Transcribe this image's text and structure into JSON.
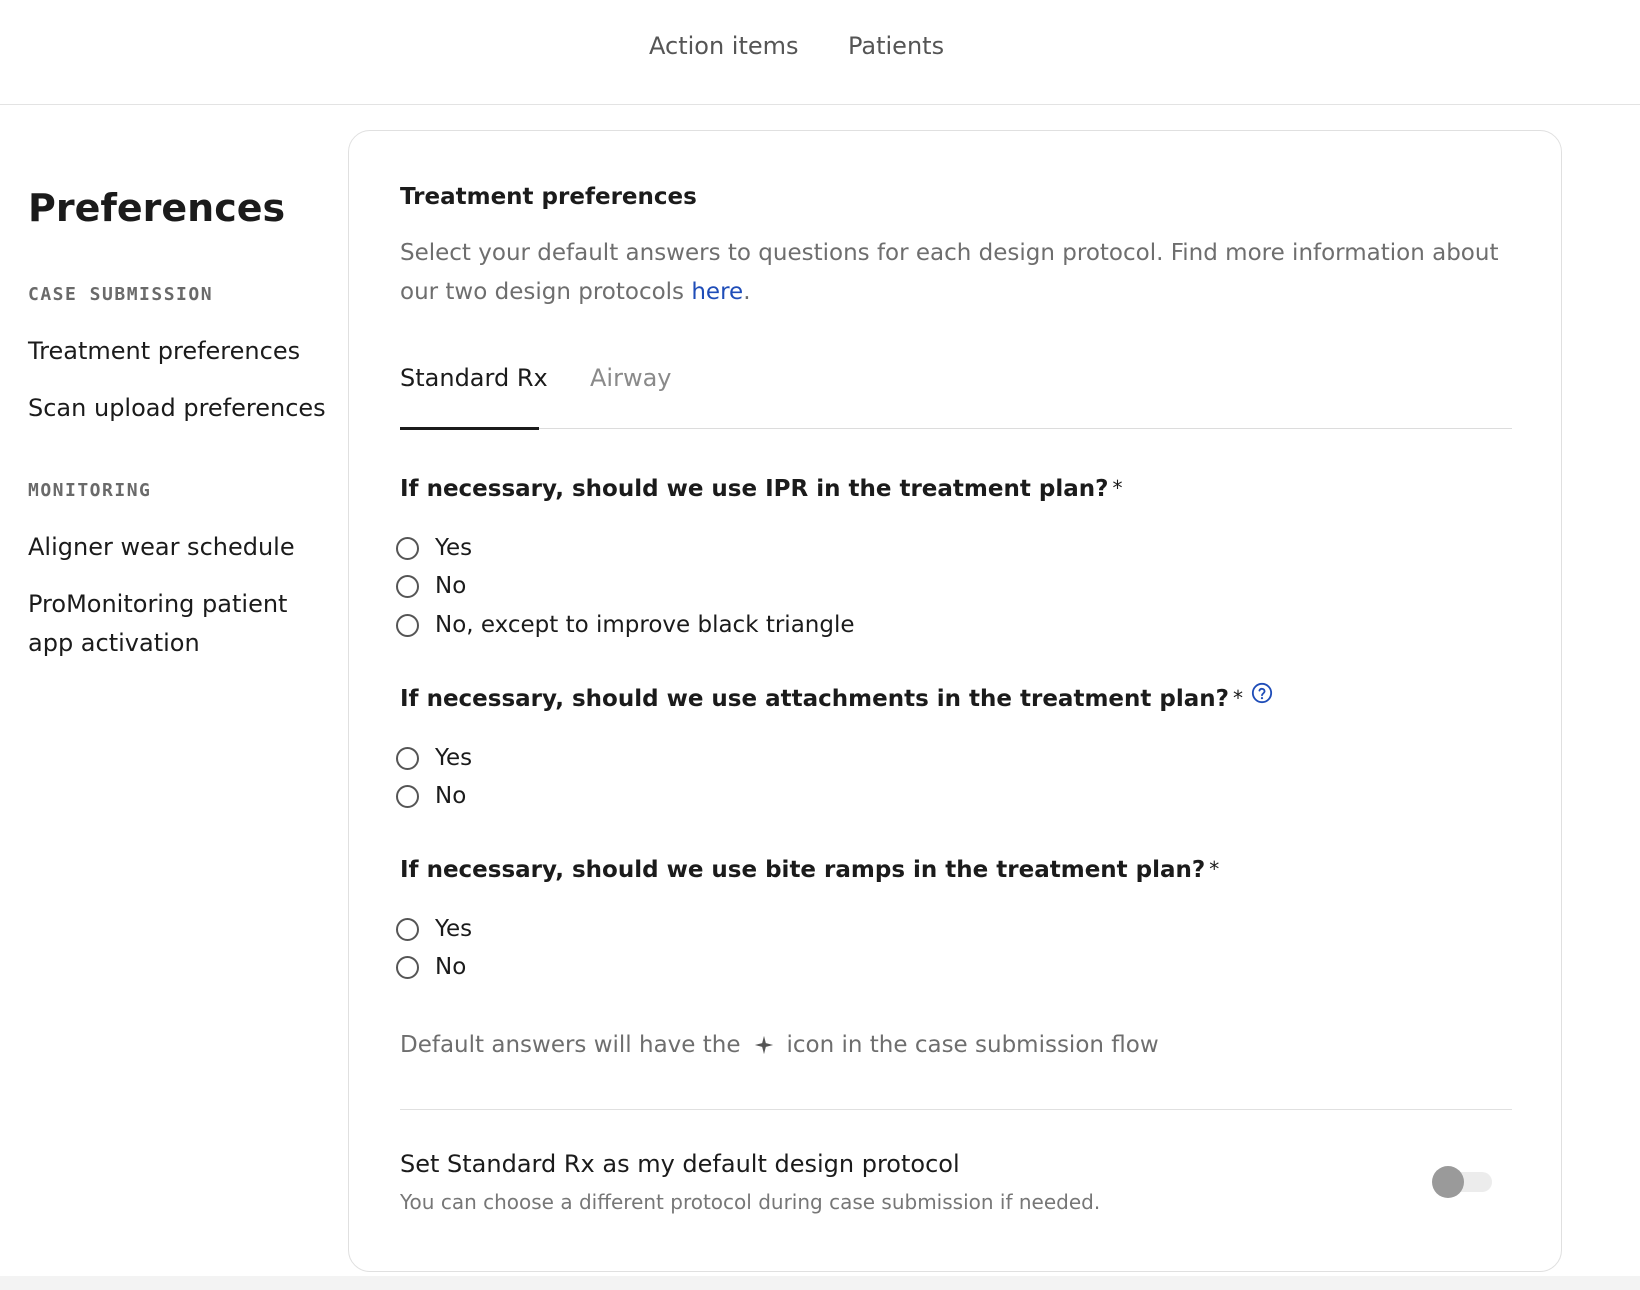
{
  "topnav": {
    "items": [
      {
        "label": "Action items"
      },
      {
        "label": "Patients"
      }
    ]
  },
  "sidebar": {
    "title": "Preferences",
    "sections": [
      {
        "heading": "CASE SUBMISSION",
        "items": [
          {
            "label": "Treatment preferences"
          },
          {
            "label": "Scan upload preferences"
          }
        ]
      },
      {
        "heading": "MONITORING",
        "items": [
          {
            "label": "Aligner wear schedule"
          },
          {
            "label": "ProMonitoring patient app activation"
          }
        ]
      }
    ]
  },
  "main": {
    "title": "Treatment preferences",
    "description": "Select your default answers to questions for each design protocol. Find more information about our two design protocols ",
    "description_link": "here",
    "description_end": ".",
    "tabs": [
      {
        "label": "Standard Rx",
        "active": true
      },
      {
        "label": "Airway",
        "active": false
      }
    ],
    "questions": [
      {
        "text": "If necessary, should we use IPR in the treatment plan?",
        "required": "*",
        "options": [
          "Yes",
          "No",
          "No, except to improve black triangle"
        ]
      },
      {
        "text": "If necessary, should we use attachments in the treatment plan?",
        "required": "*",
        "options": [
          "Yes",
          "No"
        ]
      },
      {
        "text": "If necessary, should we use bite ramps in the treatment plan?",
        "required": "*",
        "options": [
          "Yes",
          "No"
        ]
      }
    ],
    "footnote_before": "Default answers will have the",
    "footnote_after": "icon in the case submission flow",
    "default_protocol": {
      "title": "Set Standard Rx as my default design protocol",
      "subtitle": "You can choose a different protocol during case submission if needed.",
      "enabled": false
    }
  },
  "colors": {
    "link": "#1f4db8",
    "text": "#1b1b1b",
    "muted": "#6e6e6e"
  }
}
